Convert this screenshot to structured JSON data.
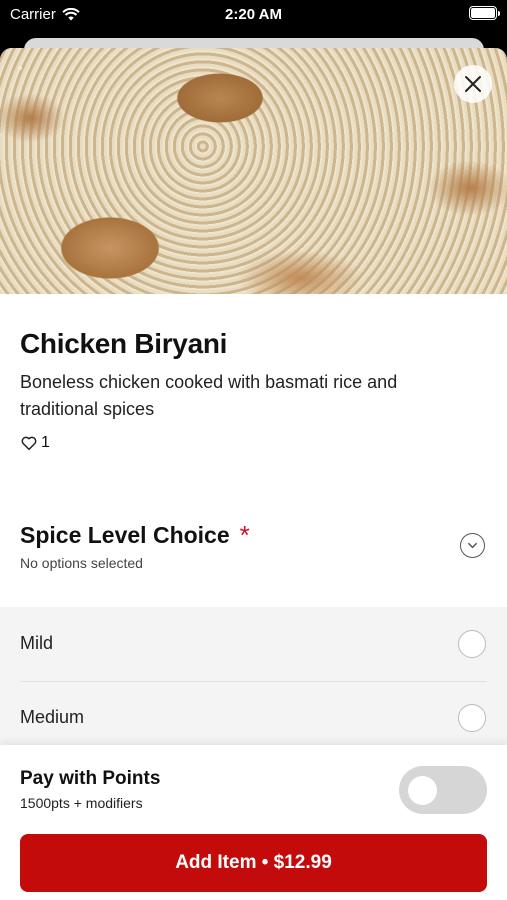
{
  "status_bar": {
    "carrier": "Carrier",
    "time": "2:20 AM"
  },
  "item": {
    "image_icon": "biryani-photo",
    "name": "Chicken Biryani",
    "description": "Boneless chicken cooked with basmati rice and traditional spices",
    "likes": "1"
  },
  "choice_group": {
    "title": "Spice Level Choice",
    "required_marker": "*",
    "subtitle": "No options selected",
    "options": [
      {
        "label": "Mild",
        "selected": false
      },
      {
        "label": "Medium",
        "selected": false
      }
    ]
  },
  "points": {
    "title": "Pay with Points",
    "subtitle": "1500pts + modifiers",
    "enabled": false
  },
  "add_button": {
    "label": "Add Item • $12.99"
  },
  "colors": {
    "accent": "#c40b0b",
    "required": "#c8102e"
  }
}
